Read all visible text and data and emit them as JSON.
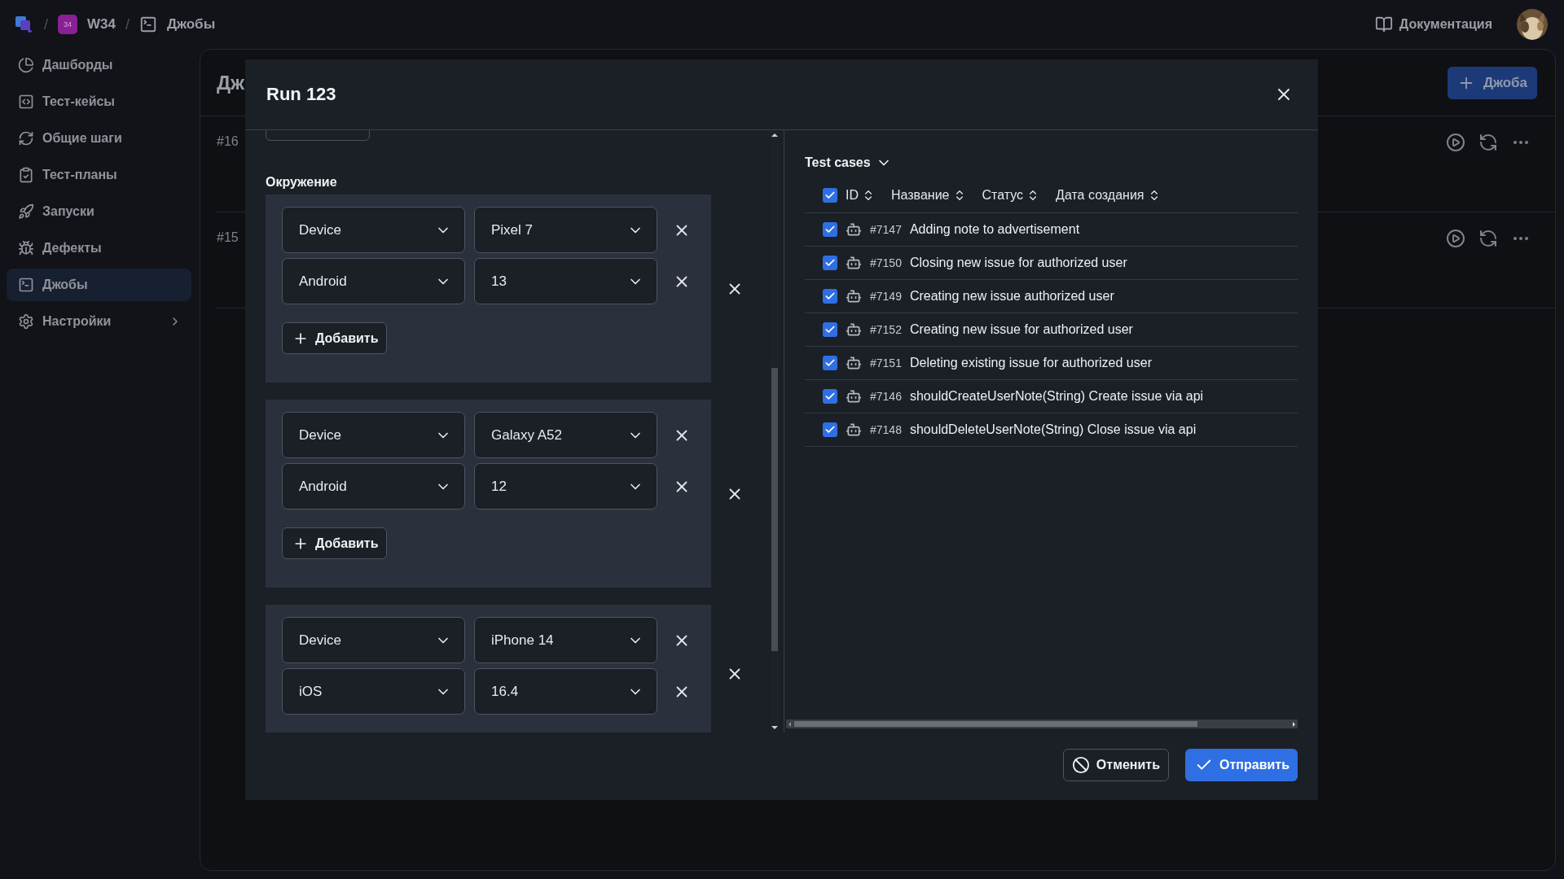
{
  "breadcrumbs": {
    "separator": "/",
    "project_badge": "34",
    "project": "W34",
    "page": "Джобы"
  },
  "header": {
    "docs_link": "Документация"
  },
  "sidebar": {
    "items": [
      {
        "label": "Дашборды",
        "selected": false,
        "has_submenu": false
      },
      {
        "label": "Тест-кейсы",
        "selected": false,
        "has_submenu": false
      },
      {
        "label": "Общие шаги",
        "selected": false,
        "has_submenu": false
      },
      {
        "label": "Тест-планы",
        "selected": false,
        "has_submenu": false
      },
      {
        "label": "Запуски",
        "selected": false,
        "has_submenu": false
      },
      {
        "label": "Дефекты",
        "selected": false,
        "has_submenu": false
      },
      {
        "label": "Джобы",
        "selected": true,
        "has_submenu": false
      },
      {
        "label": "Настройки",
        "selected": false,
        "has_submenu": true
      }
    ]
  },
  "page": {
    "title": "Дж",
    "new_button": "Джоба",
    "rows": [
      {
        "id": "#16"
      },
      {
        "id": "#15"
      }
    ]
  },
  "modal": {
    "title": "Run 123",
    "section_label": "Окружение",
    "groups": [
      {
        "params": [
          {
            "key": "Device",
            "value": "Pixel 7"
          },
          {
            "key": "Android",
            "value": "13"
          }
        ],
        "add_label": "Добавить"
      },
      {
        "params": [
          {
            "key": "Device",
            "value": "Galaxy A52"
          },
          {
            "key": "Android",
            "value": "12"
          }
        ],
        "add_label": "Добавить"
      },
      {
        "params": [
          {
            "key": "Device",
            "value": "iPhone 14"
          },
          {
            "key": "iOS",
            "value": "16.4"
          }
        ]
      }
    ],
    "test_cases": {
      "title": "Test cases",
      "all_checked": true,
      "columns": [
        "ID",
        "Название",
        "Статус",
        "Дата создания"
      ],
      "rows": [
        {
          "checked": true,
          "id": "#7147",
          "name": "Adding note to advertisement"
        },
        {
          "checked": true,
          "id": "#7150",
          "name": "Closing new issue for authorized user"
        },
        {
          "checked": true,
          "id": "#7149",
          "name": "Creating new issue authorized user"
        },
        {
          "checked": true,
          "id": "#7152",
          "name": "Creating new issue for authorized user"
        },
        {
          "checked": true,
          "id": "#7151",
          "name": "Deleting existing issue for authorized user"
        },
        {
          "checked": true,
          "id": "#7146",
          "name": "shouldCreateUserNote(String) Create issue via api"
        },
        {
          "checked": true,
          "id": "#7148",
          "name": "shouldDeleteUserNote(String) Close issue via api"
        }
      ]
    },
    "cancel_button": "Отменить",
    "submit_button": "Отправить"
  }
}
